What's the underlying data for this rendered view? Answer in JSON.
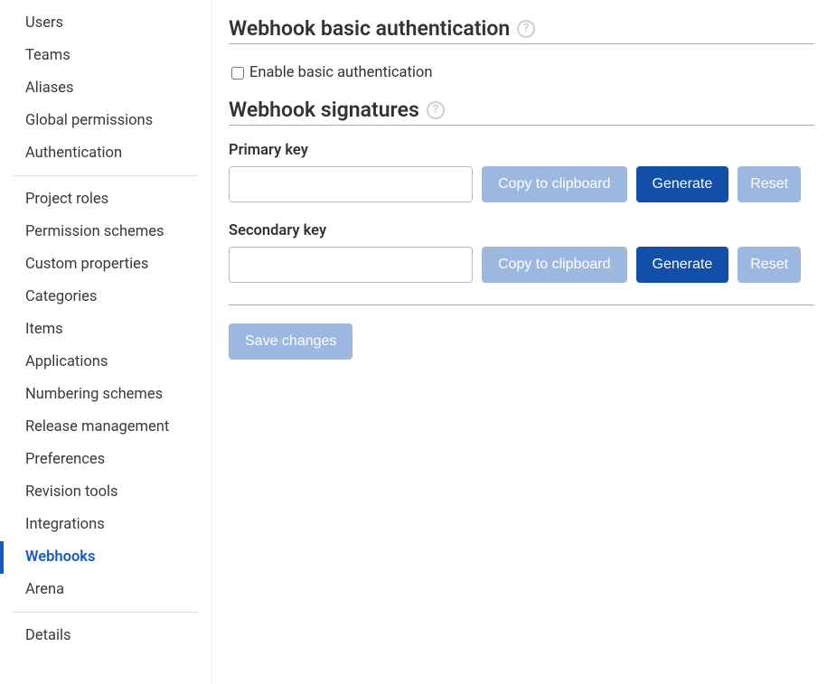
{
  "sidebar": {
    "group1": {
      "items": [
        {
          "label": "Users"
        },
        {
          "label": "Teams"
        },
        {
          "label": "Aliases"
        },
        {
          "label": "Global permissions"
        },
        {
          "label": "Authentication"
        }
      ]
    },
    "group2": {
      "items": [
        {
          "label": "Project roles"
        },
        {
          "label": "Permission schemes"
        },
        {
          "label": "Custom properties"
        },
        {
          "label": "Categories"
        },
        {
          "label": "Items"
        },
        {
          "label": "Applications"
        },
        {
          "label": "Numbering schemes"
        },
        {
          "label": "Release management"
        },
        {
          "label": "Preferences"
        },
        {
          "label": "Revision tools"
        },
        {
          "label": "Integrations"
        },
        {
          "label": "Webhooks",
          "active": true
        },
        {
          "label": "Arena"
        }
      ]
    },
    "group3": {
      "items": [
        {
          "label": "Details"
        }
      ]
    }
  },
  "main": {
    "auth_section": {
      "title": "Webhook basic authentication",
      "checkbox_label": "Enable basic authentication",
      "checkbox_checked": false
    },
    "sig_section": {
      "title": "Webhook signatures",
      "primary": {
        "label": "Primary key",
        "value": "",
        "copy_btn": "Copy to clipboard",
        "generate_btn": "Generate",
        "reset_btn": "Reset"
      },
      "secondary": {
        "label": "Secondary key",
        "value": "",
        "copy_btn": "Copy to clipboard",
        "generate_btn": "Generate",
        "reset_btn": "Reset"
      }
    },
    "save_btn": "Save changes",
    "help_glyph": "?"
  }
}
